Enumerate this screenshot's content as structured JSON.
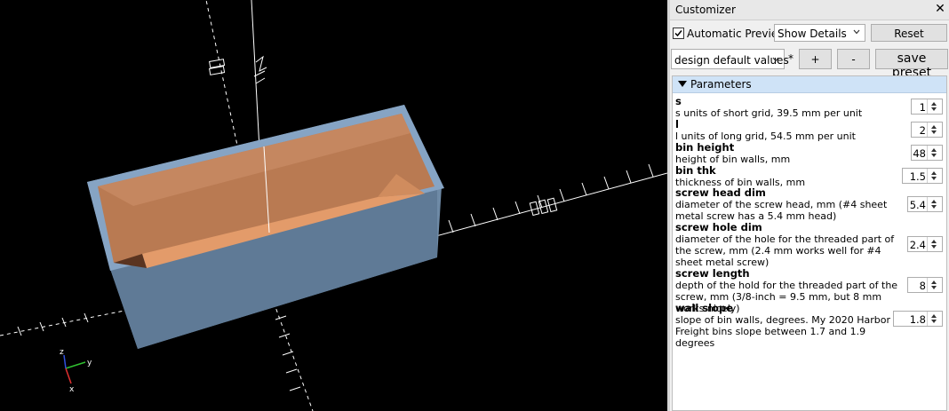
{
  "panel": {
    "title": "Customizer",
    "close_glyph": "✕"
  },
  "toolbar": {
    "auto_preview_checked": true,
    "auto_preview_label": "Automatic Preview",
    "details_select": "Show Details",
    "reset_label": "Reset",
    "preset_select": "design default values",
    "modified_marker": "*",
    "add_preset_label": "+",
    "remove_preset_label": "-",
    "save_preset_label": "save preset"
  },
  "parameters": {
    "header": "Parameters",
    "items": [
      {
        "name": "s",
        "description": "s units of short grid, 39.5 mm per unit",
        "value": "1"
      },
      {
        "name": "l",
        "description": "l units of long grid, 54.5 mm per unit",
        "value": "2"
      },
      {
        "name": "bin height",
        "description": "height of bin walls, mm",
        "value": "48"
      },
      {
        "name": "bin thk",
        "description": "thickness of bin walls, mm",
        "value": "1.5"
      },
      {
        "name": "screw head dim",
        "description": "diameter of the screw head, mm (#4 sheet metal screw has a 5.4 mm head)",
        "value": "5.4"
      },
      {
        "name": "screw hole dim",
        "description": "diameter of the hole for the threaded part of the screw, mm (2.4 mm works well for #4 sheet metal screw)",
        "value": "2.4"
      },
      {
        "name": "screw length",
        "description": "depth of the hold for the threaded part of the screw, mm (3/8-inch = 9.5 mm, but 8 mm works nicely)",
        "value": "8"
      },
      {
        "name": "wall slope",
        "description": "slope of bin walls, degrees. My 2020 Harbor Freight bins slope between 1.7 and 1.9 degrees",
        "value": "1.8"
      }
    ]
  },
  "viewport": {
    "axis_labels": {
      "x": "x",
      "y": "y",
      "z": "z"
    },
    "colors": {
      "background": "#000000",
      "bin_outer": "#6e8aa6",
      "bin_rim": "#86a4c4",
      "bin_inner": "#b97a52",
      "bin_floor": "#e39b6a",
      "axis_x": "#e03030",
      "axis_y": "#30c030",
      "axis_z": "#3050e0"
    }
  },
  "icons": {
    "checkbox": "checkbox-checked-icon",
    "dropdown": "chevron-down-icon",
    "collapse": "triangle-down-icon",
    "spin_up": "spin-up-icon",
    "spin_down": "spin-down-icon"
  }
}
